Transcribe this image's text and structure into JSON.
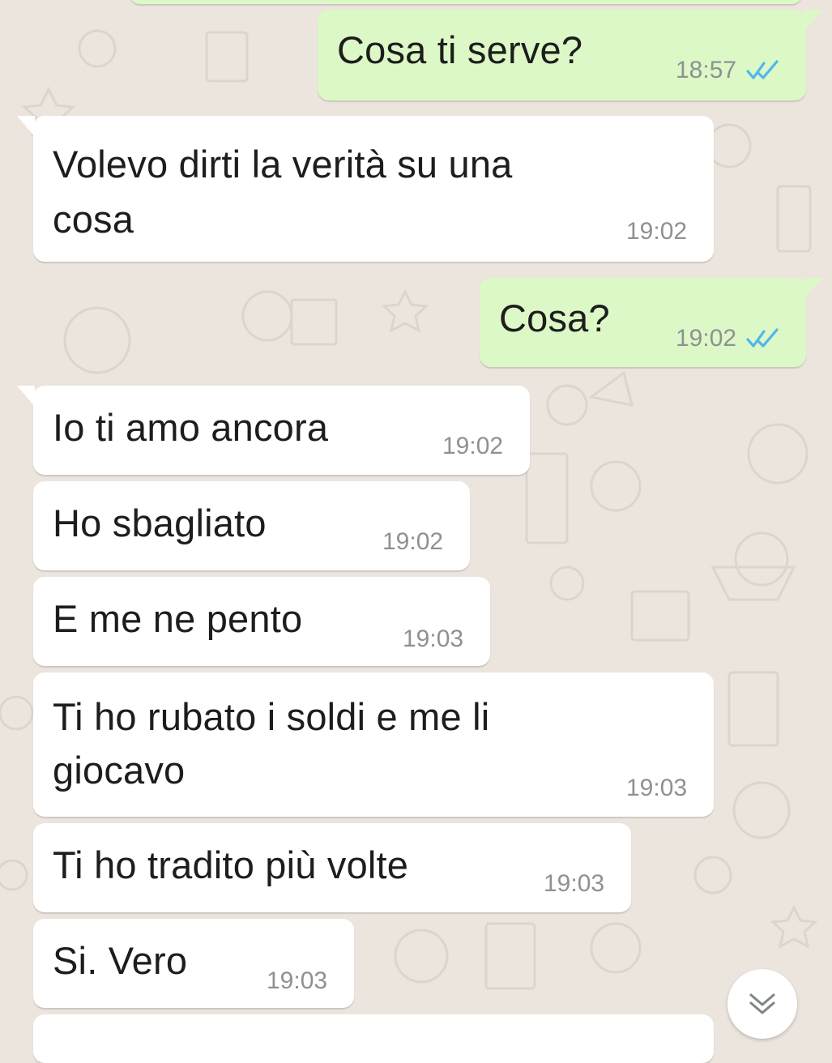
{
  "chat": {
    "messages": [
      {
        "direction": "out",
        "text": "Cosa ti serve?",
        "time": "18:57",
        "status": "read"
      },
      {
        "direction": "in",
        "text": "Volevo dirti la verità su una\ncosa",
        "time": "19:02"
      },
      {
        "direction": "out",
        "text": "Cosa?",
        "time": "19:02",
        "status": "read"
      },
      {
        "direction": "in",
        "text": "Io ti amo ancora",
        "time": "19:02"
      },
      {
        "direction": "in",
        "text": "Ho sbagliato",
        "time": "19:02"
      },
      {
        "direction": "in",
        "text": "E me ne pento",
        "time": "19:03"
      },
      {
        "direction": "in",
        "text": "Ti ho rubato i soldi e me li\ngiocavo",
        "time": "19:03"
      },
      {
        "direction": "in",
        "text": "Ti ho tradito più volte",
        "time": "19:03"
      },
      {
        "direction": "in",
        "text": "Si. Vero",
        "time": "19:03"
      }
    ]
  },
  "icons": {
    "read_receipt": "double-check-icon",
    "scroll_down": "chevron-double-down-icon"
  },
  "colors": {
    "background": "#ece5dd",
    "incoming_bubble": "#ffffff",
    "outgoing_bubble": "#dcf8c6",
    "read_ticks": "#4fb6ec",
    "timestamp": "#8e9192"
  }
}
